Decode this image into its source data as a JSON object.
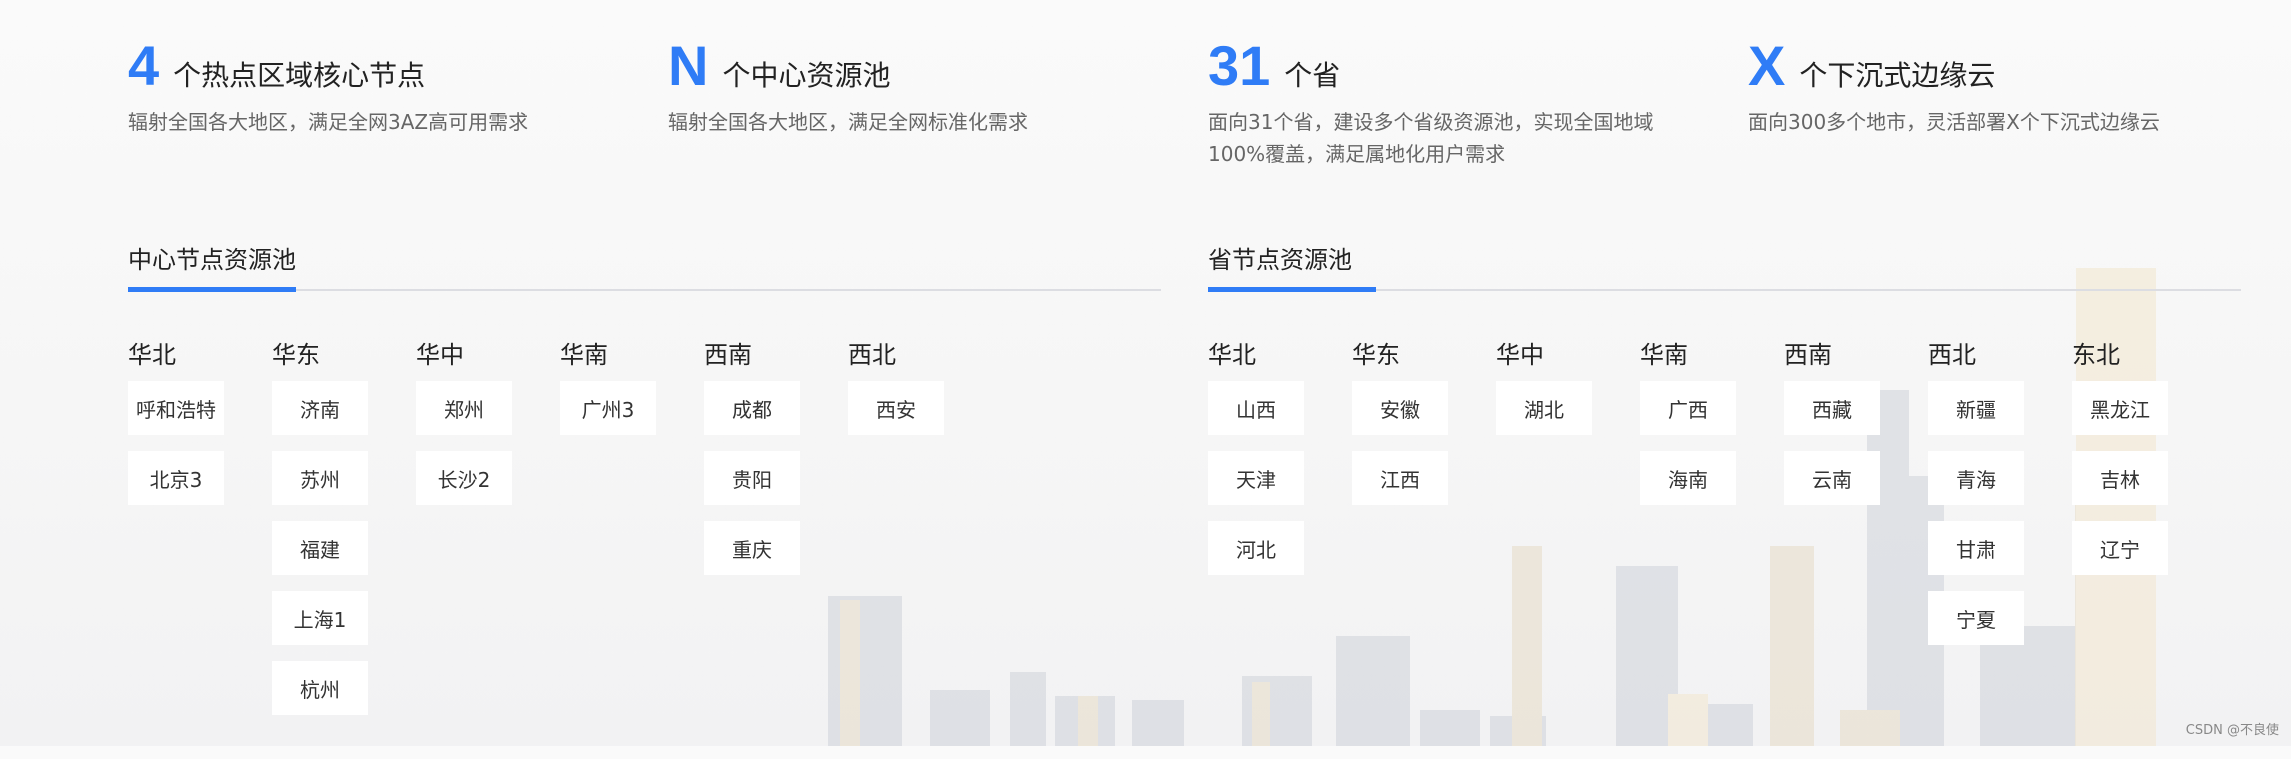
{
  "stats": [
    {
      "number": "4",
      "label": "个热点区域核心节点",
      "desc": "辐射全国各大地区，满足全网3AZ高可用需求"
    },
    {
      "number": "N",
      "label": "个中心资源池",
      "desc": "辐射全国各大地区，满足全网标准化需求"
    },
    {
      "number": "31",
      "label": "个省",
      "desc": "面向31个省，建设多个省级资源池，实现全国地域100%覆盖，满足属地化用户需求"
    },
    {
      "number": "X",
      "label": "个下沉式边缘云",
      "desc": "面向300多个地市，灵活部署X个下沉式边缘云"
    }
  ],
  "center_pool": {
    "title": "中心节点资源池",
    "regions": [
      {
        "name": "华北",
        "cities": [
          "呼和浩特",
          "北京3"
        ]
      },
      {
        "name": "华东",
        "cities": [
          "济南",
          "苏州",
          "福建",
          "上海1",
          "杭州"
        ]
      },
      {
        "name": "华中",
        "cities": [
          "郑州",
          "长沙2"
        ]
      },
      {
        "name": "华南",
        "cities": [
          "广州3"
        ]
      },
      {
        "name": "西南",
        "cities": [
          "成都",
          "贵阳",
          "重庆"
        ]
      },
      {
        "name": "西北",
        "cities": [
          "西安"
        ]
      }
    ]
  },
  "province_pool": {
    "title": "省节点资源池",
    "regions": [
      {
        "name": "华北",
        "cities": [
          "山西",
          "天津",
          "河北"
        ]
      },
      {
        "name": "华东",
        "cities": [
          "安徽",
          "江西"
        ]
      },
      {
        "name": "华中",
        "cities": [
          "湖北"
        ]
      },
      {
        "name": "华南",
        "cities": [
          "广西",
          "海南"
        ]
      },
      {
        "name": "西南",
        "cities": [
          "西藏",
          "云南"
        ]
      },
      {
        "name": "西北",
        "cities": [
          "新疆",
          "青海",
          "甘肃",
          "宁夏"
        ]
      },
      {
        "name": "东北",
        "cities": [
          "黑龙江",
          "吉林",
          "辽宁"
        ]
      }
    ]
  },
  "watermark": "CSDN @不良使",
  "colors": {
    "accent": "#2f7cf6",
    "card": "#ffffff",
    "rule": "#dcdde2"
  }
}
